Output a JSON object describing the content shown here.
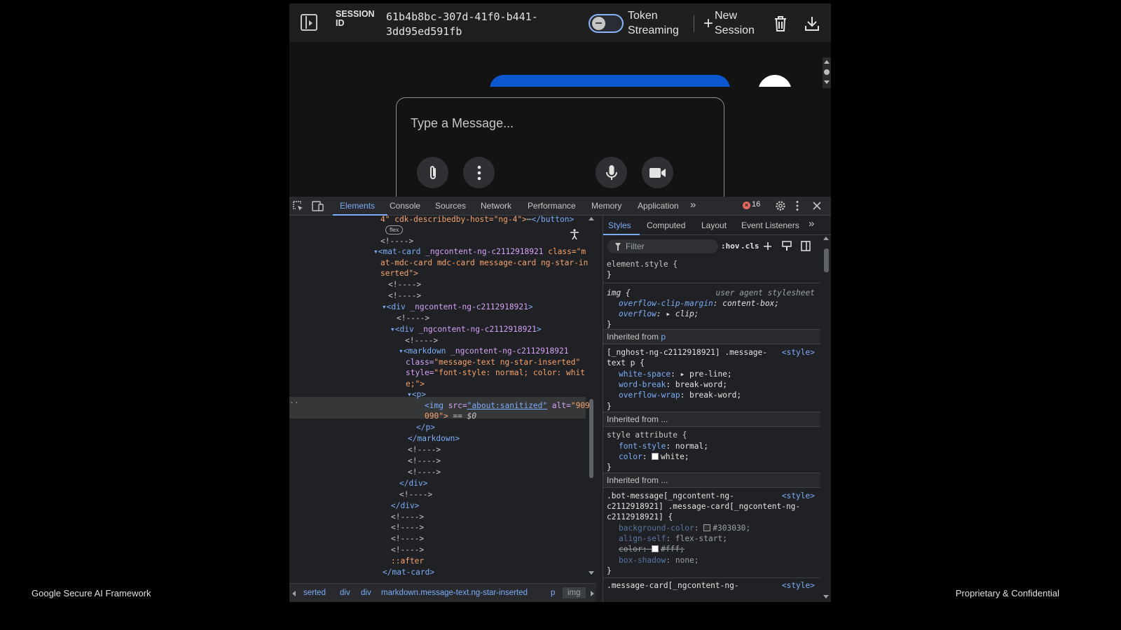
{
  "footer": {
    "left": "Google Secure AI Framework",
    "right": "Proprietary & Confidential"
  },
  "topbar": {
    "session_label": "SESSION ID",
    "session_id": "61b4b8bc-307d-41f0-b441-3dd95ed591fb",
    "token_streaming_label": "Token Streaming",
    "token_streaming_on": false,
    "new_session_label": "New Session",
    "icons": [
      "side-panel-icon",
      "delete-icon",
      "download-icon"
    ]
  },
  "chat": {
    "input_placeholder": "Type a Message...",
    "bubble_color": "#0b57d0"
  },
  "devtools": {
    "tabs": [
      "Elements",
      "Console",
      "Sources",
      "Network",
      "Performance",
      "Memory",
      "Application"
    ],
    "active_tab": "Elements",
    "more": "»",
    "error_count": "16",
    "elements": {
      "flex_badge": "flex",
      "lines": [
        {
          "a": "4\" cdk-describedby-host=\"ng-4\">",
          "b": "⋯",
          "c": "</button>"
        },
        {
          "t": "<!---->"
        },
        {
          "t1": "▾<mat-card ",
          "t2": "_ngcontent-ng-c2112918921",
          "t3": " class=\"m"
        },
        {
          "t": "at-mdc-card mdc-card message-card ng-star-in"
        },
        {
          "t": "serted\">"
        },
        {
          "t": "<!---->"
        },
        {
          "t": "<!---->"
        },
        {
          "t1": "▾<div ",
          "t2": "_ngcontent-ng-c2112918921",
          "t3": ">"
        },
        {
          "t": "<!---->"
        },
        {
          "t1": "▾<div ",
          "t2": "_ngcontent-ng-c2112918921",
          "t3": ">"
        },
        {
          "t": "<!---->"
        },
        {
          "t1": "▾<markdown ",
          "t2": "_ngcontent-ng-c2112918921"
        },
        {
          "t1": "class=",
          "t2": "\"message-text ng-star-inserted\""
        },
        {
          "t1": "style=",
          "t2": "\"font-style: normal; color: whit"
        },
        {
          "t": "e;\">"
        },
        {
          "t": "▾<p>"
        },
        {
          "t1": "<img ",
          "t2": "src=",
          "t3": "\"about:sanitized\"",
          "t4": " alt=",
          "t5": "\"909"
        },
        {
          "t1": "090\">",
          "t2": " == $0"
        },
        {
          "t": "</p>"
        },
        {
          "t": "</markdown>"
        },
        {
          "t": "<!---->"
        },
        {
          "t": "<!---->"
        },
        {
          "t": "<!---->"
        },
        {
          "t": "</div>"
        },
        {
          "t": "<!---->"
        },
        {
          "t": "</div>"
        },
        {
          "t": "<!---->"
        },
        {
          "t": "<!---->"
        },
        {
          "t": "<!---->"
        },
        {
          "t": "<!---->"
        },
        {
          "t": "::after"
        },
        {
          "t": "</mat-card>"
        }
      ],
      "breadcrumbs": [
        "serted",
        "div",
        "div",
        "markdown.message-text.ng-star-inserted",
        "p",
        "img"
      ]
    },
    "styles": {
      "tabs": [
        "Styles",
        "Computed",
        "Layout",
        "Event Listeners"
      ],
      "filter_placeholder": "Filter",
      "tools": [
        ":hov",
        ".cls"
      ],
      "element_style": "element.style {",
      "close_brace": "}",
      "ua_selector": "img {",
      "ua_source": "user agent stylesheet",
      "ua_props": [
        {
          "name": "overflow-clip-margin",
          "value": "content-box;"
        },
        {
          "name": "overflow",
          "value": "▸ clip;"
        }
      ],
      "inherited_p_prefix": "Inherited from ",
      "inherited_p_tag": "p",
      "p_selector_1": "[_nghost-ng-c2112918921] .message-",
      "p_selector_2": "text p {",
      "p_source": "<style>",
      "p_props": [
        {
          "name": "white-space",
          "value": "▸ pre-line;"
        },
        {
          "name": "word-break",
          "value": "break-word;"
        },
        {
          "name": "overflow-wrap",
          "value": "break-word;"
        }
      ],
      "inherited_2": "Inherited from ...",
      "style_attr": "style attribute {",
      "style_props": [
        {
          "name": "font-style",
          "value": "normal;"
        },
        {
          "name": "color",
          "value": "white;"
        }
      ],
      "inherited_3": "Inherited from ...",
      "bot_selector_1": ".bot-message[_ngcontent-ng-",
      "bot_selector_2": "c2112918921] .message-card[_ngcontent-ng-",
      "bot_selector_3": "c2112918921] {",
      "bot_source": "<style>",
      "bot_props": [
        {
          "name": "background-color",
          "value": "#303030;"
        },
        {
          "name": "align-self",
          "value": "flex-start;"
        },
        {
          "name": "color",
          "value": "#fff;"
        },
        {
          "name": "box-shadow",
          "value": "none;"
        }
      ],
      "last_selector": ".message-card[_ngcontent-ng-",
      "last_source": "<style>"
    }
  }
}
